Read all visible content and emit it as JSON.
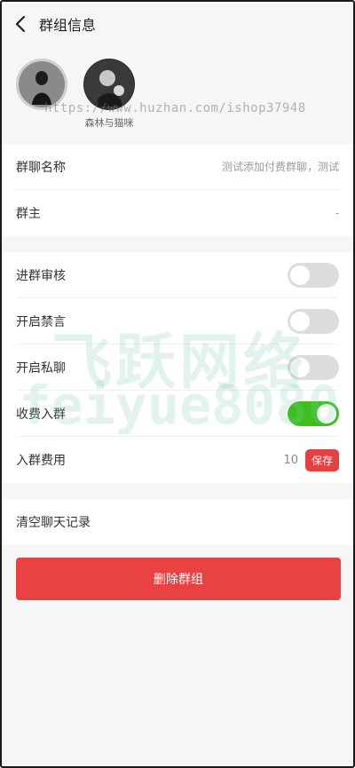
{
  "header": {
    "title": "群组信息"
  },
  "members": [
    {
      "name": ""
    },
    {
      "name": "森林与猫咪"
    }
  ],
  "watermark": {
    "url": "https://www.huzhan.com/ishop37948",
    "line1": "飞跃网络",
    "line2": "feiyue8080"
  },
  "info": {
    "group_name_label": "群聊名称",
    "group_name_value": "测试添加付费群聊，测试",
    "owner_label": "群主",
    "owner_value": "-"
  },
  "settings": {
    "join_review_label": "进群审核",
    "join_review_on": false,
    "mute_label": "开启禁言",
    "mute_on": false,
    "private_chat_label": "开启私聊",
    "private_chat_on": false,
    "paid_join_label": "收费入群",
    "paid_join_on": true,
    "fee_label": "入群费用",
    "fee_value": "10",
    "save_label": "保存"
  },
  "actions": {
    "clear_history_label": "清空聊天记录",
    "delete_group_label": "删除群组"
  },
  "colors": {
    "accent_red": "#e84242",
    "toggle_on": "#3fbf1f",
    "toggle_off": "#dcdcdc"
  }
}
